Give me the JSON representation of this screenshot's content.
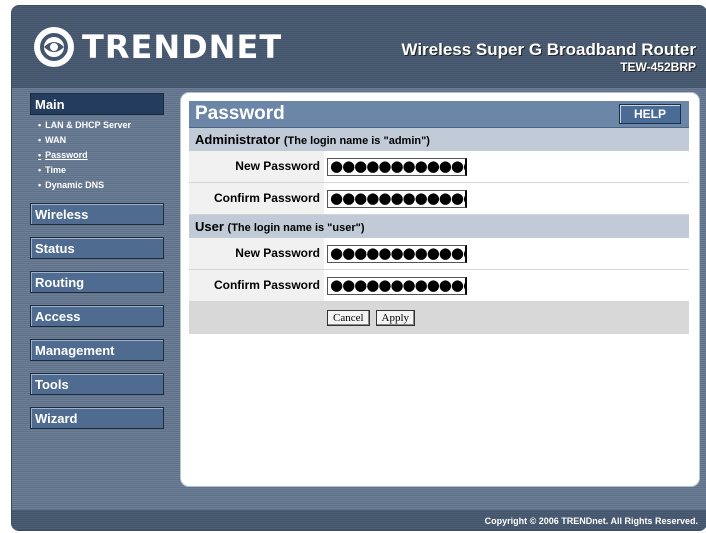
{
  "brand": {
    "logo_text": "TRENDNET",
    "product_title": "Wireless Super G Broadband Router",
    "model": "TEW-452BRP"
  },
  "nav": {
    "main": "Main",
    "sub": [
      "LAN & DHCP Server",
      "WAN",
      "Password",
      "Time",
      "Dynamic DNS"
    ],
    "active_sub": "Password",
    "items": [
      "Wireless",
      "Status",
      "Routing",
      "Access",
      "Management",
      "Tools",
      "Wizard"
    ]
  },
  "panel": {
    "title": "Password",
    "help": "HELP",
    "admin": {
      "heading": "Administrator",
      "note": "(The login name is \"admin\")",
      "new_label": "New Password",
      "confirm_label": "Confirm Password",
      "new_value": "●●●●●●●●●●●●",
      "confirm_value": "●●●●●●●●●●●●"
    },
    "user": {
      "heading": "User",
      "note": "(The login name is \"user\")",
      "new_label": "New Password",
      "confirm_label": "Confirm Password",
      "new_value": "●●●●●●●●●●●●",
      "confirm_value": "●●●●●●●●●●●●"
    },
    "cancel": "Cancel",
    "apply": "Apply"
  },
  "footer": "Copyright © 2006 TRENDnet. All Rights Reserved.",
  "colors": {
    "panel_title": "#6b86a7",
    "section": "#c1cbd7",
    "nav_button": "#4f6b8f",
    "nav_main": "#243c5d"
  }
}
